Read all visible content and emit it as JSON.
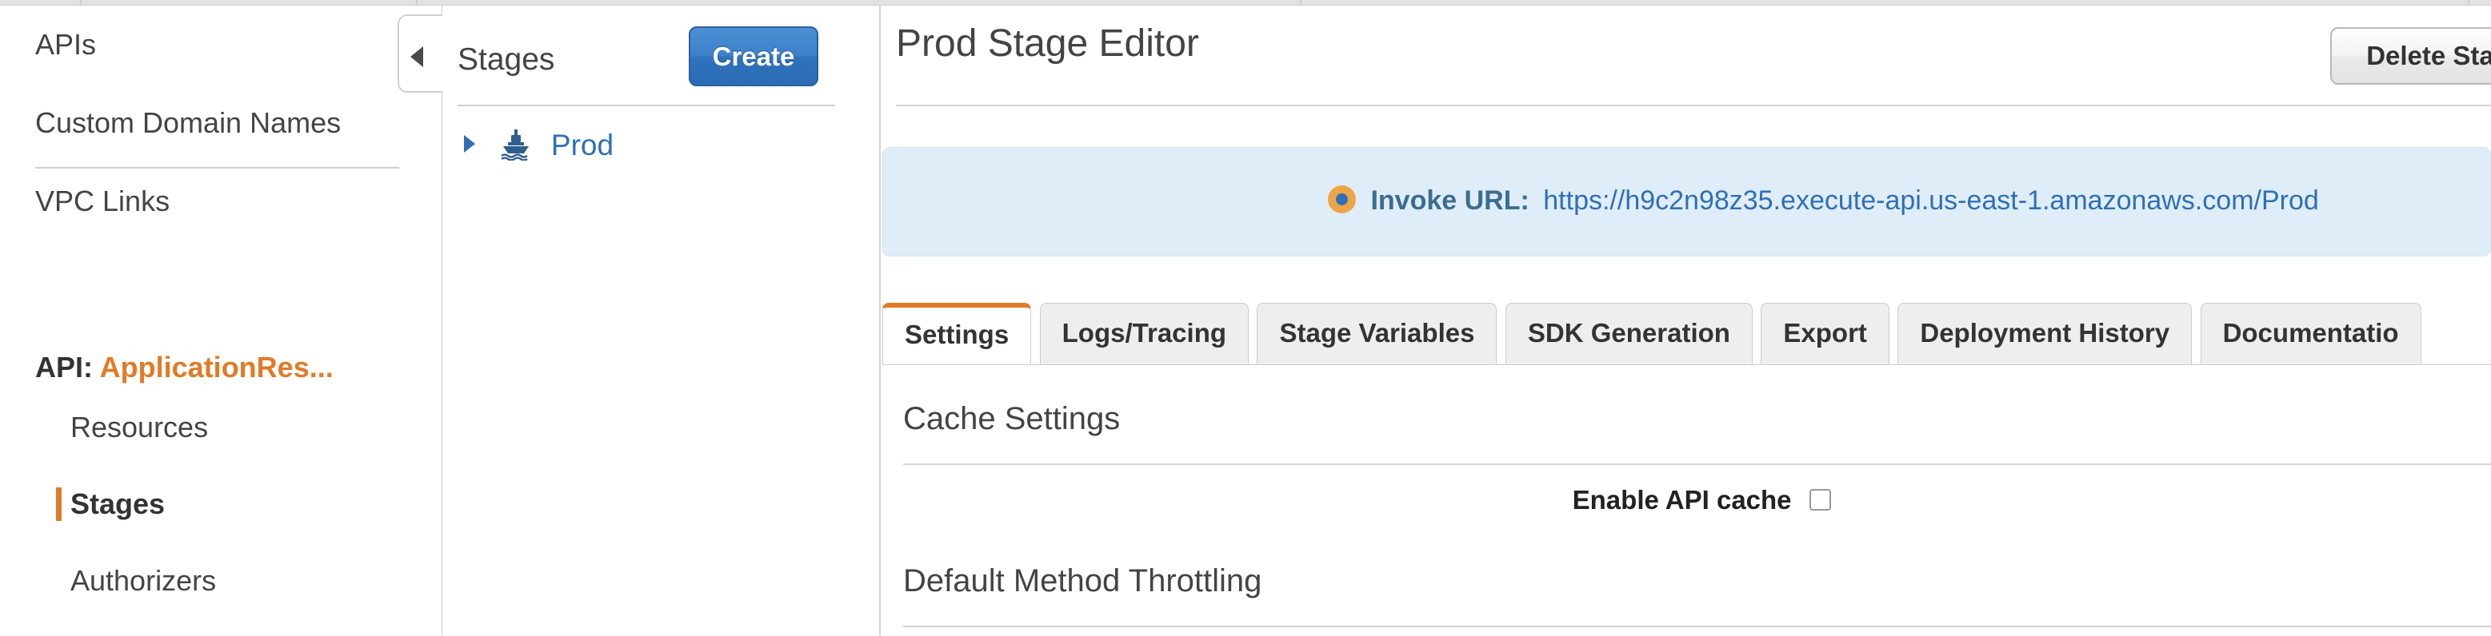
{
  "nav": {
    "global_items": [
      {
        "label": "APIs",
        "icon": "none"
      },
      {
        "label": "Custom Domain Names",
        "icon": "none"
      },
      {
        "label": "VPC Links",
        "icon": "none"
      }
    ],
    "api_prefix": "API:",
    "api_name": "ApplicationRes...",
    "api_items": [
      {
        "label": "Resources",
        "selected": false
      },
      {
        "label": "Stages",
        "selected": true
      },
      {
        "label": "Authorizers",
        "selected": false
      }
    ],
    "collapse_icon": "caret-left-icon"
  },
  "stages_panel": {
    "title": "Stages",
    "create_label": "Create",
    "stages": [
      {
        "name": "Prod",
        "expander_icon": "caret-right-icon",
        "stage_icon": "ship-icon",
        "expanded": false
      }
    ]
  },
  "main": {
    "title": "Prod Stage Editor",
    "delete_label": "Delete Sta",
    "invoke": {
      "icon": "info-circle-icon",
      "label": "Invoke URL:",
      "url": "https://h9c2n98z35.execute-api.us-east-1.amazonaws.com/Prod"
    },
    "tabs": [
      {
        "label": "Settings",
        "active": true
      },
      {
        "label": "Logs/Tracing",
        "active": false
      },
      {
        "label": "Stage Variables",
        "active": false
      },
      {
        "label": "SDK Generation",
        "active": false
      },
      {
        "label": "Export",
        "active": false
      },
      {
        "label": "Deployment History",
        "active": false
      },
      {
        "label": "Documentatio",
        "active": false
      }
    ],
    "settings": {
      "cache_heading": "Cache Settings",
      "enable_cache_label": "Enable API cache",
      "enable_cache_checked": false,
      "throttling_heading": "Default Method Throttling"
    }
  },
  "colors": {
    "accent_orange": "#e07b28",
    "link_blue": "#2f6fb5",
    "banner_bg": "#dfedf8",
    "create_button_blue": "#3d82c9",
    "info_icon_orange": "#eda54a"
  }
}
